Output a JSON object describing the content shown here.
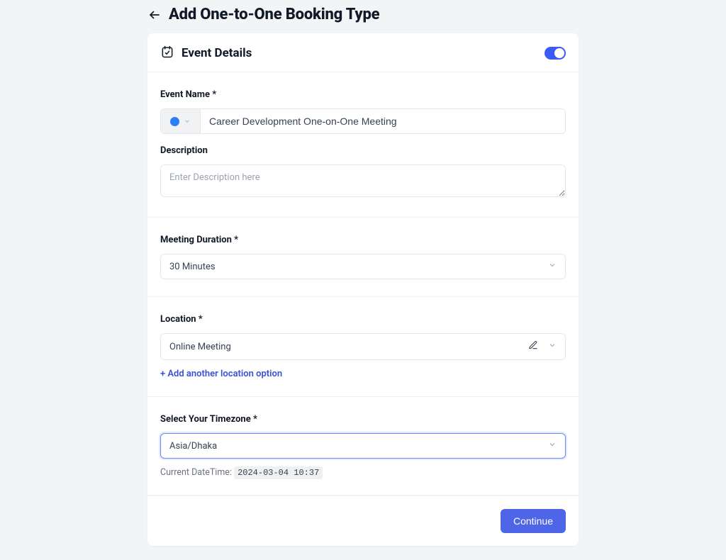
{
  "header": {
    "title": "Add One-to-One Booking Type"
  },
  "card": {
    "title": "Event Details"
  },
  "eventName": {
    "label": "Event Name *",
    "value": "Career Development One-on-One Meeting"
  },
  "description": {
    "label": "Description",
    "placeholder": "Enter Description here"
  },
  "duration": {
    "label": "Meeting Duration *",
    "value": "30 Minutes"
  },
  "location": {
    "label": "Location *",
    "value": "Online Meeting",
    "addLink": "+ Add another location option"
  },
  "timezone": {
    "label": "Select Your Timezone *",
    "value": "Asia/Dhaka",
    "noteLabel": "Current DateTime:",
    "noteValue": "2024-03-04 10:37"
  },
  "footer": {
    "continue": "Continue"
  }
}
